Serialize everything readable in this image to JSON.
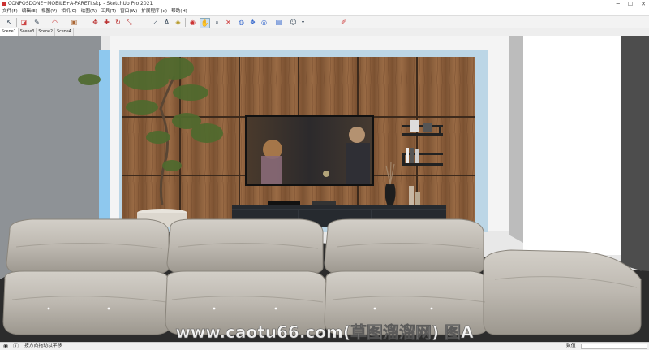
{
  "window": {
    "title": "CONPOSDONE+MOBILE+A-PARETI.skp - SketchUp Pro 2021",
    "controls": [
      "─",
      "☐",
      "✕"
    ]
  },
  "menu": [
    "文件(F)",
    "编辑(E)",
    "视图(V)",
    "相机(C)",
    "绘图(R)",
    "工具(T)",
    "窗口(W)",
    "扩展程序 (x)",
    "帮助(H)"
  ],
  "toolbar": {
    "tools": [
      {
        "name": "select-tool",
        "glyph": "↖"
      },
      {
        "name": "eraser-tool",
        "glyph": "◪"
      },
      {
        "name": "line-tool",
        "glyph": "✎"
      },
      {
        "name": "arc-tool",
        "glyph": "◠"
      },
      {
        "name": "shape-tool",
        "glyph": "▣"
      },
      {
        "name": "push-pull-tool",
        "glyph": "✥"
      },
      {
        "name": "move-tool",
        "glyph": "✚"
      },
      {
        "name": "rotate-tool",
        "glyph": "↻"
      },
      {
        "name": "scale-tool",
        "glyph": "⤡"
      },
      {
        "name": "tape-measure-tool",
        "glyph": "⊿"
      },
      {
        "name": "text-tool",
        "glyph": "A"
      },
      {
        "name": "paint-bucket-tool",
        "glyph": "◈"
      },
      {
        "name": "orbit-tool",
        "glyph": "◉"
      },
      {
        "name": "pan-tool",
        "glyph": "✋"
      },
      {
        "name": "zoom-tool",
        "glyph": "⌕"
      },
      {
        "name": "zoom-extents-tool",
        "glyph": "✕"
      },
      {
        "name": "warehouse-tool",
        "glyph": "◍"
      },
      {
        "name": "extension-warehouse-tool",
        "glyph": "❖"
      },
      {
        "name": "sketchfab-tool",
        "glyph": "◎"
      },
      {
        "name": "layout-tool",
        "glyph": "▤"
      },
      {
        "name": "account-tool",
        "glyph": "☺"
      },
      {
        "name": "section-tool",
        "glyph": "✐"
      }
    ]
  },
  "scenes": [
    "Scene1",
    "Scene3",
    "Scene2",
    "Scene4"
  ],
  "status": {
    "message": "按方向拖动以平移",
    "measure_label": "数值",
    "measure_value": ""
  },
  "watermark": "www.caotu66.com(草图溜溜网) 图A"
}
